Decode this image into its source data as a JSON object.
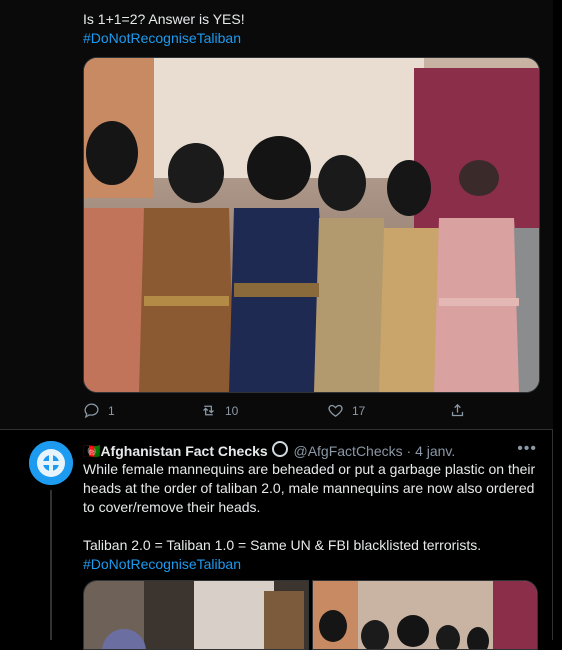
{
  "tweet1": {
    "text": "Is 1+1=2? Answer is YES!",
    "hashtag": "#DoNotRecogniseTaliban",
    "actions": {
      "reply": "1",
      "retweet": "10",
      "like": "17"
    },
    "media_alt_icon": "image-photo"
  },
  "tweet2": {
    "display_name": "Afghanistan Fact Checks",
    "flag_emoji": "🇦🇫",
    "handle": "@AfgFactChecks",
    "separator": "·",
    "date": "4 janv.",
    "more_icon": "•••",
    "paragraph1": "While female mannequins are beheaded or put a garbage plastic on their heads at the order of taliban 2.0, male mannequins are now also ordered to cover/remove their heads.",
    "paragraph2": "Taliban 2.0 = Taliban 1.0 = Same UN & FBI blacklisted terrorists.",
    "hashtag": "#DoNotRecogniseTaliban"
  },
  "colors": {
    "accent": "#1d9bf0",
    "muted": "#8b98a5",
    "text": "#e7e9ea",
    "border": "#2f3336"
  }
}
